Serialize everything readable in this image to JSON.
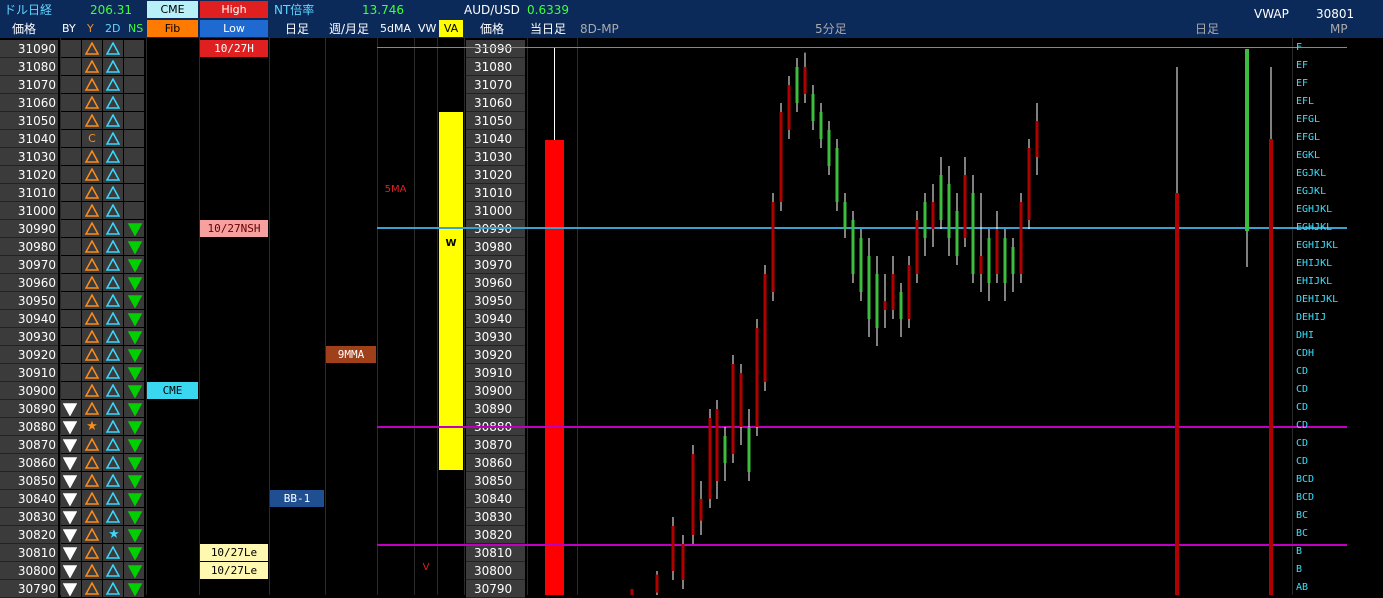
{
  "header": {
    "nikkei_dollar_label": "ドル日経",
    "nikkei_dollar_value": "206.31",
    "cme_label": "CME",
    "high_label": "High",
    "fib_label": "Fib",
    "low_label": "Low",
    "nt_label": "NT倍率",
    "nt_value": "13.746",
    "audusd_label": "AUD/USD",
    "audusd_value": "0.6339",
    "vwap_label": "VWAP",
    "vwap_value": "30801"
  },
  "columns": {
    "price": "価格",
    "by": "BY",
    "y": "Y",
    "two_d": "2D",
    "ns": "NS",
    "daily": "日足",
    "weekly_monthly": "週/月足",
    "five_dma": "5dMA",
    "vw": "VW",
    "va": "VA",
    "price2": "価格",
    "today_daily": "当日足",
    "mp_8d": "8D-MP",
    "five_min": "5分足",
    "daily2": "日足",
    "mp": "MP"
  },
  "prices": [
    "31090",
    "31080",
    "31070",
    "31060",
    "31050",
    "31040",
    "31030",
    "31020",
    "31010",
    "31000",
    "30990",
    "30980",
    "30970",
    "30960",
    "30950",
    "30940",
    "30930",
    "30920",
    "30910",
    "30900",
    "30890",
    "30880",
    "30870",
    "30860",
    "30850",
    "30840",
    "30830",
    "30820",
    "30810",
    "30800",
    "30790"
  ],
  "prices_right": [
    "31090",
    "31080",
    "31070",
    "31060",
    "31050",
    "31040",
    "31030",
    "31020",
    "31010",
    "31000",
    "30990",
    "30980",
    "30970",
    "30960",
    "30950",
    "30940",
    "30930",
    "30920",
    "30910",
    "30900",
    "30890",
    "30880",
    "30870",
    "30860",
    "30850",
    "30840",
    "30830",
    "30820",
    "30810",
    "30800",
    "30790"
  ],
  "tags": {
    "high_1027": "10/27H",
    "nsh_1027": "10/27NSH",
    "cme_mark": "CME",
    "bb1": "BB-1",
    "le_1027_a": "10/27Le",
    "le_1027_b": "10/27Le",
    "ma9": "9MMA",
    "ma5": "5MA",
    "w_mark": "W",
    "v_mark": "V",
    "c_mark": "C"
  },
  "mp_letters": [
    "F",
    "EF",
    "EF",
    "EFL",
    "EFGL",
    "EFGL",
    "EGKL",
    "EGJKL",
    "EGJKL",
    "EGHJKL",
    "EGHJKL",
    "EGHIJKL",
    "EHIJKL",
    "EHIJKL",
    "DEHIJKL",
    "DEHIJ",
    "DHI",
    "CDH",
    "CD",
    "CD",
    "CD",
    "CD",
    "CD",
    "CD",
    "BCD",
    "BCD",
    "BC",
    "BC",
    "B",
    "B",
    "AB"
  ],
  "colors": {
    "header_bg": "#0b2a5a",
    "up_green": "#3dbd3d",
    "down_red": "#b00000",
    "va_yellow": "#ffff00",
    "today_red": "#ff0000",
    "line_blue": "#3aa0d0",
    "line_magenta": "#c000c0",
    "triangle_orange": "#ff8c1a",
    "triangle_cyan": "#3ad7ff",
    "triangle_green": "#00d000"
  }
}
